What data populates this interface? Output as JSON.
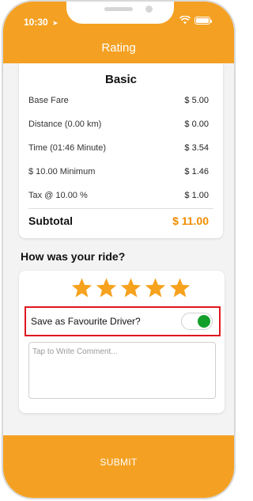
{
  "status_bar": {
    "time": "10:30",
    "location_icon": "location-arrow-icon",
    "wifi_icon": "wifi-icon",
    "battery_icon": "battery-icon"
  },
  "header": {
    "title": "Rating"
  },
  "fare": {
    "title": "Basic",
    "rows": [
      {
        "label": "Base Fare",
        "value": "$ 5.00"
      },
      {
        "label": "Distance (0.00 km)",
        "value": "$ 0.00"
      },
      {
        "label": "Time (01:46 Minute)",
        "value": "$ 3.54"
      },
      {
        "label": "$ 10.00 Minimum",
        "value": "$ 1.46"
      },
      {
        "label": "Tax @ 10.00 %",
        "value": "$ 1.00"
      }
    ],
    "subtotal_label": "Subtotal",
    "subtotal_value": "$ 11.00"
  },
  "rating": {
    "question": "How was your ride?",
    "stars": 5,
    "max_stars": 5,
    "favourite_label": "Save as Favourite Driver?",
    "favourite_on": true,
    "comment_placeholder": "Tap to Write Comment...",
    "comment_value": ""
  },
  "submit_label": "SUBMIT",
  "colors": {
    "accent": "#f4a123",
    "subtotal": "#f08c00",
    "star": "#f6a21e",
    "toggle_on": "#12a02a",
    "highlight_border": "#e0161f"
  }
}
